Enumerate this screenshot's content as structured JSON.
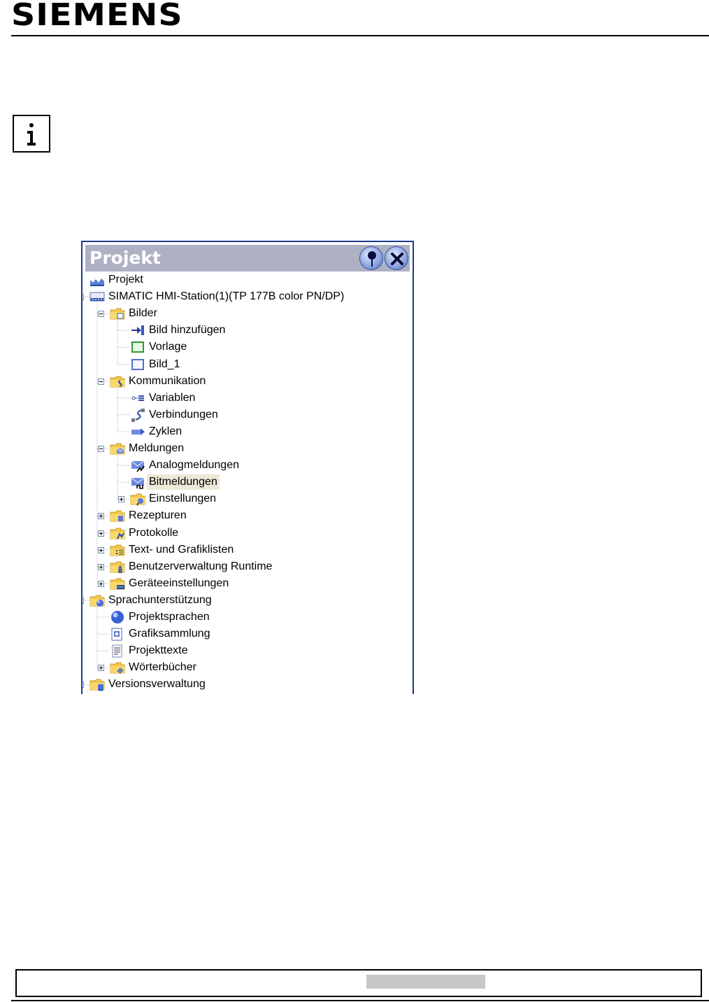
{
  "header": {
    "brand": "SIEMENS"
  },
  "info_icon": "info-icon",
  "panel": {
    "title": "Projekt",
    "pin_icon": "pin-icon",
    "close_icon": "close-icon"
  },
  "tree": [
    {
      "label": "Projekt",
      "level": 0,
      "icon": "project-icon",
      "toggle": "none"
    },
    {
      "label": "SIMATIC HMI-Station(1)(TP 177B color PN/DP)",
      "level": 0,
      "icon": "hmi-station-icon",
      "toggle": "minus"
    },
    {
      "label": "Bilder",
      "level": 1,
      "icon": "folder-screens-icon",
      "toggle": "minus"
    },
    {
      "label": "Bild hinzufügen",
      "level": 2,
      "icon": "add-screen-icon",
      "toggle": "none"
    },
    {
      "label": "Vorlage",
      "level": 2,
      "icon": "template-icon",
      "toggle": "none"
    },
    {
      "label": "Bild_1",
      "level": 2,
      "icon": "screen-icon",
      "toggle": "none"
    },
    {
      "label": "Kommunikation",
      "level": 1,
      "icon": "folder-communication-icon",
      "toggle": "minus"
    },
    {
      "label": "Variablen",
      "level": 2,
      "icon": "tags-icon",
      "toggle": "none"
    },
    {
      "label": "Verbindungen",
      "level": 2,
      "icon": "connections-icon",
      "toggle": "none"
    },
    {
      "label": "Zyklen",
      "level": 2,
      "icon": "cycles-icon",
      "toggle": "none"
    },
    {
      "label": "Meldungen",
      "level": 1,
      "icon": "folder-alarms-icon",
      "toggle": "minus"
    },
    {
      "label": "Analogmeldungen",
      "level": 2,
      "icon": "analog-alarms-icon",
      "toggle": "none"
    },
    {
      "label": "Bitmeldungen",
      "level": 2,
      "icon": "bit-alarms-icon",
      "toggle": "none",
      "selected": true
    },
    {
      "label": "Einstellungen",
      "level": 2,
      "icon": "folder-settings-icon",
      "toggle": "plus"
    },
    {
      "label": "Rezepturen",
      "level": 1,
      "icon": "folder-recipes-icon",
      "toggle": "plus"
    },
    {
      "label": "Protokolle",
      "level": 1,
      "icon": "folder-logs-icon",
      "toggle": "plus"
    },
    {
      "label": "Text- und Grafiklisten",
      "level": 1,
      "icon": "folder-lists-icon",
      "toggle": "plus"
    },
    {
      "label": "Benutzerverwaltung Runtime",
      "level": 1,
      "icon": "folder-users-icon",
      "toggle": "plus"
    },
    {
      "label": "Geräteeinstellungen",
      "level": 1,
      "icon": "folder-device-settings-icon",
      "toggle": "plus"
    },
    {
      "label": "Sprachunterstützung",
      "level": 0,
      "icon": "folder-language-icon",
      "toggle": "minus"
    },
    {
      "label": "Projektsprachen",
      "level": 1,
      "icon": "globe-icon",
      "toggle": "none"
    },
    {
      "label": "Grafiksammlung",
      "level": 1,
      "icon": "graphics-icon",
      "toggle": "none"
    },
    {
      "label": "Projekttexte",
      "level": 1,
      "icon": "texts-icon",
      "toggle": "none"
    },
    {
      "label": "Wörterbücher",
      "level": 1,
      "icon": "folder-dictionaries-icon",
      "toggle": "plus"
    },
    {
      "label": "Versionsverwaltung",
      "level": 0,
      "icon": "folder-versions-icon",
      "toggle": "plus"
    }
  ]
}
